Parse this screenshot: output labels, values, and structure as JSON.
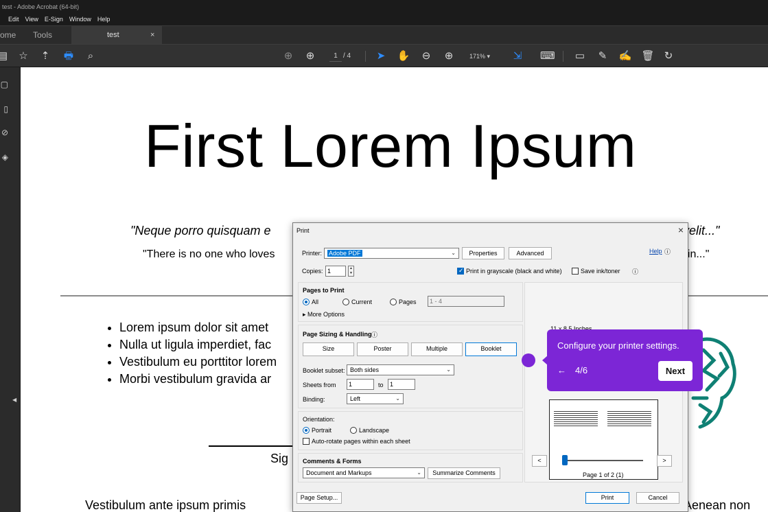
{
  "window": {
    "title": "test - Adobe Acrobat (64-bit)"
  },
  "menu": [
    "Edit",
    "View",
    "E-Sign",
    "Window",
    "Help"
  ],
  "tabs": {
    "home": "ome",
    "tools": "Tools",
    "doc": "test",
    "close": "×"
  },
  "toolbar": {
    "page_current": "1",
    "page_total": "/ 4",
    "zoom": "171% ▾"
  },
  "document": {
    "title": "First Lorem Ipsum",
    "quote1_left": "\"Neque porro quisquam e",
    "quote1_right": "velit...\"",
    "quote2_left": "\"There is no one who loves",
    "quote2_right": "ain...\"",
    "bullets": [
      "Lorem ipsum dolor sit amet",
      "Nulla ut ligula imperdiet, fac",
      "Vestibulum eu porttitor lorem",
      "Morbi vestibulum gravida ar"
    ],
    "signature": "Sig",
    "para_left": "Vestibulum ante ipsum primis",
    "para_right": "Aenean non"
  },
  "print_dialog": {
    "title": "Print",
    "close": "×",
    "printer_label": "Printer:",
    "printer_value": "Adobe PDF",
    "properties": "Properties",
    "advanced": "Advanced",
    "help": "Help",
    "copies_label": "Copies:",
    "copies_value": "1",
    "grayscale": "Print in grayscale (black and white)",
    "grayscale_checked": true,
    "save_ink": "Save ink/toner",
    "pages_to_print": {
      "heading": "Pages to Print",
      "all": "All",
      "current": "Current",
      "pages": "Pages",
      "pages_range": "1 - 4",
      "more_options": "More Options"
    },
    "sizing": {
      "heading": "Page Sizing & Handling",
      "size": "Size",
      "poster": "Poster",
      "multiple": "Multiple",
      "booklet": "Booklet",
      "booklet_subset_label": "Booklet subset:",
      "booklet_subset_value": "Both sides",
      "sheets_from_label": "Sheets from",
      "sheets_from": "1",
      "to_label": "to",
      "sheets_to": "1",
      "binding_label": "Binding:",
      "binding_value": "Left"
    },
    "orientation": {
      "heading": "Orientation:",
      "portrait": "Portrait",
      "landscape": "Landscape",
      "autorotate": "Auto-rotate pages within each sheet"
    },
    "comments": {
      "heading": "Comments & Forms",
      "value": "Document and Markups",
      "summarize": "Summarize Comments"
    },
    "preview": {
      "size": "11 x 8.5 Inches",
      "page_info": "Page 1 of 2 (1)",
      "prev": "<",
      "next": ">"
    },
    "page_setup": "Page Setup...",
    "print": "Print",
    "cancel": "Cancel"
  },
  "tooltip": {
    "message": "Configure your printer settings.",
    "back": "←",
    "step": "4/6",
    "next": "Next",
    "color": "#7c26d6"
  }
}
